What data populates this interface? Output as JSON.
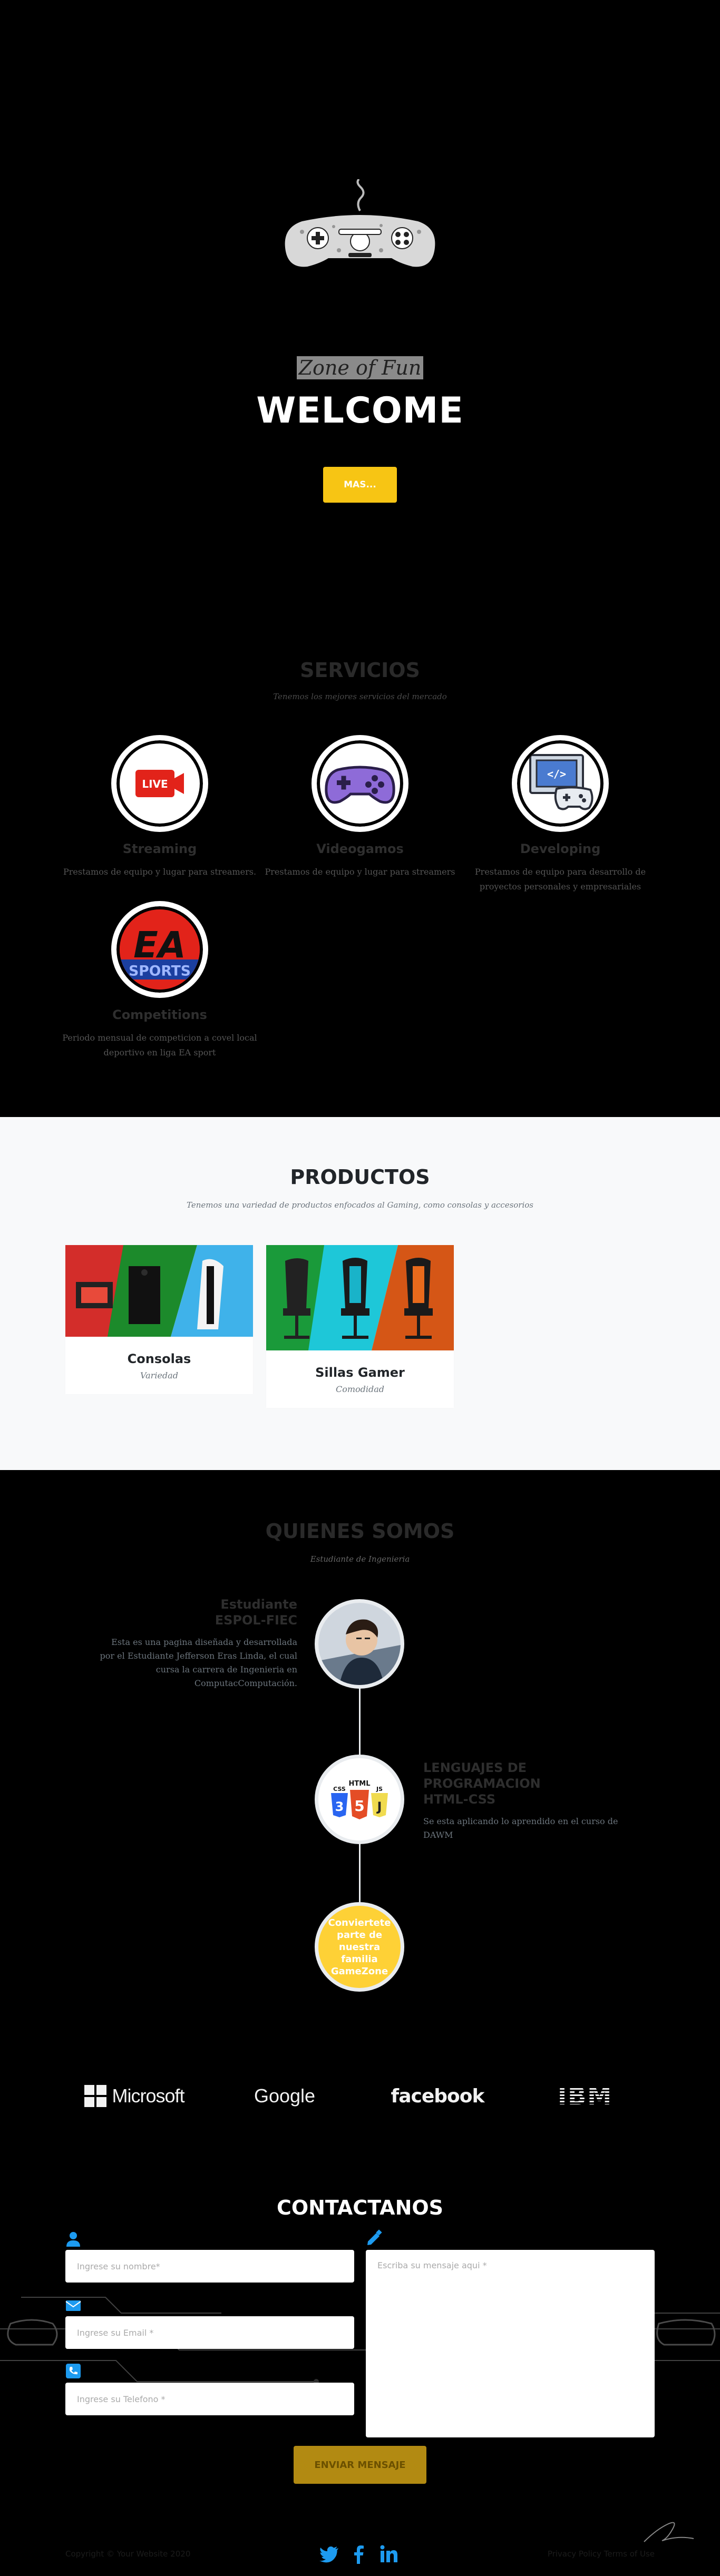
{
  "hero": {
    "tagline": "Zone of Fun",
    "title": "WELCOME",
    "button_label": "MAS..."
  },
  "servicios": {
    "title": "SERVICIOS",
    "subtitle": "Tenemos los mejores servicios del mercado",
    "items": [
      {
        "icon": "live-stream-icon",
        "badge": "LIVE",
        "title": "Streaming",
        "text": "Prestamos de equipo y lugar para streamers."
      },
      {
        "icon": "gamepad-icon",
        "title": "Videogamos",
        "text": "Prestamos de equipo y lugar para streamers"
      },
      {
        "icon": "developing-icon",
        "title": "Developing",
        "text": "Prestamos de equipo para desarrollo de proyectos personales y empresariales"
      },
      {
        "icon": "ea-sports-icon",
        "badge": "EA",
        "badge2": "SPORTS",
        "title": "Competitions",
        "text": "Periodo mensual de competicion a covel local deportivo en liga EA sport"
      }
    ]
  },
  "productos": {
    "title": "PRODUCTOS",
    "subtitle": "Tenemos una variedad de productos enfocados al Gaming, como consolas y accesorios",
    "items": [
      {
        "title": "Consolas",
        "subtitle": "Variedad"
      },
      {
        "title": "Sillas Gamer",
        "subtitle": "Comodidad"
      }
    ]
  },
  "quienes": {
    "title": "QUIENES SOMOS",
    "subtitle": "Estudiante de Ingenieria",
    "entries": [
      {
        "heading_1": "Estudiante",
        "heading_2": "ESPOL-FIEC",
        "text": "Esta es una pagina diseñada y desarrollada por el Estudiante Jefferson Eras Linda, el cual cursa la carrera de Ingenieria en ComputacComputación."
      },
      {
        "heading_1": "LENGUAJES DE",
        "heading_2": "PROGRAMACION",
        "heading_3": "HTML-CSS",
        "text": "Se esta aplicando lo aprendido en el curso de DAWM",
        "badge": "HTML",
        "badge_css": "CSS",
        "badge_js": "JS"
      }
    ],
    "final": "Conviertete parte de nuestra familia GameZone"
  },
  "clients": [
    "Microsoft",
    "Google",
    "facebook",
    "IBM"
  ],
  "contact": {
    "title": "CONTACTANOS",
    "name_placeholder": "Ingrese su nombre*",
    "email_placeholder": "Ingrese su Email *",
    "phone_placeholder": "Ingrese su Telefono *",
    "message_placeholder": "Escriba su mensaje aqui *",
    "send_label": "ENVIAR MENSAJE"
  },
  "footer": {
    "copyright": "Copyright © Your Website 2020",
    "links": "Privacy Policy   Terms of Use"
  },
  "colors": {
    "accent": "#fed136",
    "hero_button": "#f7c514",
    "send_button": "#b28a12",
    "social_blue": "#1d9bf0"
  }
}
